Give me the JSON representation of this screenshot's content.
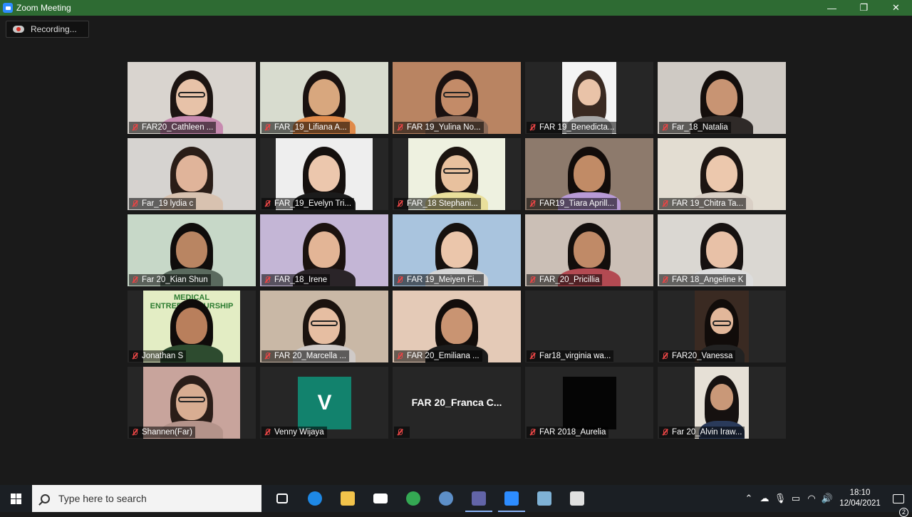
{
  "window": {
    "title": "Zoom Meeting",
    "controls": {
      "minimize": "—",
      "restore": "❐",
      "close": "✕"
    }
  },
  "recording": {
    "label": "Recording..."
  },
  "participants": [
    {
      "name": "FAR20_Cathleen ...",
      "bg": "#d9d4cf",
      "skin": "#e7c2a8",
      "hair": "#1c1412",
      "shirt": "#c78ab0",
      "glasses": true
    },
    {
      "name": "FAR_19_Lifiana A...",
      "bg": "#d8dccf",
      "skin": "#d8a77e",
      "hair": "#1a1210",
      "shirt": "#e08a4a",
      "glasses": false
    },
    {
      "name": "FAR 19_Yulina No...",
      "bg": "#b98462",
      "skin": "#c38b68",
      "hair": "#1a1110",
      "shirt": "#8a6a58",
      "glasses": true
    },
    {
      "name": "FAR 19_Benedicta...",
      "bg": "#f4f4f4",
      "skin": "#e9c3a8",
      "hair": "#3a2a22",
      "shirt": "#a7a7a7",
      "glasses": false
    },
    {
      "name": "Far_18_Natalia",
      "bg": "#cfcac4",
      "skin": "#c89473",
      "hair": "#140e0c",
      "shirt": "#2f2a28",
      "glasses": false
    },
    {
      "name": "Far_19 lydia c",
      "bg": "#d6d3d0",
      "skin": "#e0b49a",
      "hair": "#2a1d17",
      "shirt": "#d8c2b0",
      "glasses": false
    },
    {
      "name": "FAR_19_Evelyn Tri...",
      "bg": "#eeeeee",
      "skin": "#ecc7ad",
      "hair": "#15100e",
      "shirt": "#1b1b1b",
      "glasses": false
    },
    {
      "name": "FAR_18 Stephani...",
      "bg": "#eef1e0",
      "skin": "#e8c19e",
      "hair": "#1b1410",
      "shirt": "#e9df9b",
      "glasses": true
    },
    {
      "name": "FAR19_Tiara Aprill...",
      "bg": "#8d7a6c",
      "skin": "#c18b66",
      "hair": "#120c0a",
      "shirt": "#b89ad6",
      "glasses": false
    },
    {
      "name": "FAR 19_Chitra Ta...",
      "bg": "#e3ddd2",
      "skin": "#ecc8ad",
      "hair": "#1d1512",
      "shirt": "#d9cfc5",
      "glasses": false
    },
    {
      "name": "Far 20_Kian Shun",
      "bg": "#c7d8c8",
      "skin": "#b98562",
      "hair": "#0f0c0b",
      "shirt": "#5a6a5e",
      "glasses": false
    },
    {
      "name": "FAR_18_Irene",
      "bg": "#c4b6d6",
      "skin": "#e3b596",
      "hair": "#1b120f",
      "shirt": "#2a2428",
      "glasses": false
    },
    {
      "name": "FAR 19_Meiyen Fi...",
      "bg": "#a9c4de",
      "skin": "#ebc6ab",
      "hair": "#16110f",
      "shirt": "#d5d5d5",
      "glasses": false
    },
    {
      "name": "FAR_20_Pricillia",
      "bg": "#cbbfb6",
      "skin": "#c08a67",
      "hair": "#130e0c",
      "shirt": "#b34a52",
      "glasses": false
    },
    {
      "name": "FAR 18_Angeline K",
      "bg": "#dad7d2",
      "skin": "#e8c1a7",
      "hair": "#161110",
      "shirt": "#dcdcdc",
      "glasses": false
    },
    {
      "name": "Jonathan S",
      "bg": "#e3edc4",
      "skin": "#b97f5c",
      "hair": "#0f0b0a",
      "shirt": "#2d4b2f",
      "glasses": false,
      "banner": "MEDICAL ENTREPRENEURSHIP"
    },
    {
      "name": "FAR 20_Marcella ...",
      "bg": "#c9b8a6",
      "skin": "#e6bea2",
      "hair": "#1b130f",
      "shirt": "#cfcac8",
      "glasses": true
    },
    {
      "name": "FAR 20_Emiliana ...",
      "bg": "#e4cab7",
      "skin": "#c99472",
      "hair": "#120d0b",
      "shirt": "#1c1c1c",
      "glasses": false
    },
    {
      "name": "Far18_virginia wa...",
      "bg": "#262626",
      "empty": true
    },
    {
      "name": "FAR20_Vanessa",
      "bg": "#3a2a22",
      "skin": "#e2b79a",
      "hair": "#110c0a",
      "shirt": "#222",
      "glasses": true
    },
    {
      "name": "Shannen(Far)",
      "bg": "#c8a49c",
      "skin": "#d8ad92",
      "hair": "#2a1d18",
      "shirt": "#b4938a",
      "glasses": true
    },
    {
      "name": "Venny Wijaya",
      "avatar_letter": "V"
    },
    {
      "name": "",
      "center_name": "FAR 20_Franca C..."
    },
    {
      "name": "FAR 2018_Aurelia",
      "black": true
    },
    {
      "name": "Far 20_Alvin Iraw...",
      "bg": "#e6e0d6",
      "skin": "#c99878",
      "hair": "#161110",
      "shirt": "#2a3a5a",
      "glasses": false
    }
  ],
  "taskbar": {
    "search_placeholder": "Type here to search",
    "apps": [
      {
        "icon": "task-view-icon",
        "color": "#ffffff",
        "active": false
      },
      {
        "icon": "edge-icon",
        "color": "#1e88e5",
        "active": false
      },
      {
        "icon": "file-explorer-icon",
        "color": "#f2c34b",
        "active": false
      },
      {
        "icon": "mail-icon",
        "color": "#ffffff",
        "active": false
      },
      {
        "icon": "chrome-icon",
        "color": "#34a853",
        "active": false
      },
      {
        "icon": "r-studio-icon",
        "color": "#5d8fc8",
        "active": false
      },
      {
        "icon": "teams-icon",
        "color": "#6264a7",
        "active": true
      },
      {
        "icon": "zoom-icon",
        "color": "#2d8cff",
        "active": true
      },
      {
        "icon": "notes-icon",
        "color": "#7fb2d6",
        "active": false
      },
      {
        "icon": "paint-icon",
        "color": "#e0e0e0",
        "active": false
      }
    ],
    "tray": {
      "time": "18:10",
      "date": "12/04/2021",
      "notification_count": "2"
    }
  }
}
